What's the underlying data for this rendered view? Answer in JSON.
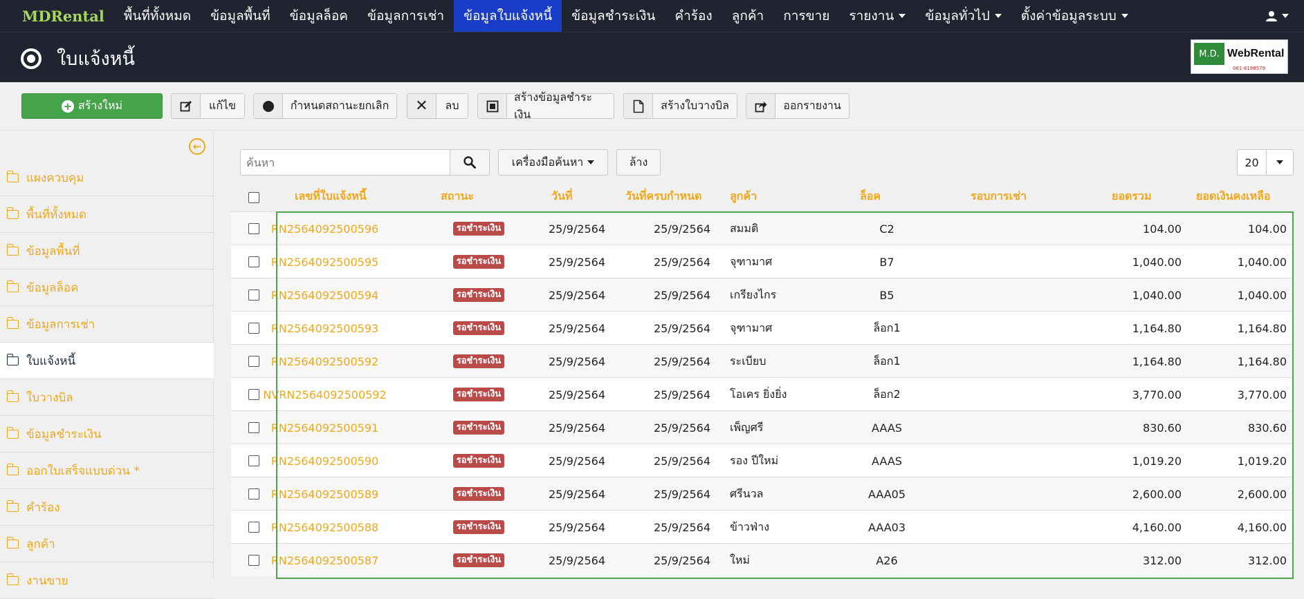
{
  "topnav": {
    "brand": "MDRental",
    "items": [
      {
        "label": "พื้นที่ทั้งหมด"
      },
      {
        "label": "ข้อมูลพื้นที่"
      },
      {
        "label": "ข้อมูลล็อค"
      },
      {
        "label": "ข้อมูลการเช่า"
      },
      {
        "label": "ข้อมูลใบแจ้งหนี้"
      },
      {
        "label": "ข้อมูลชำระเงิน"
      },
      {
        "label": "คำร้อง"
      },
      {
        "label": "ลูกค้า"
      },
      {
        "label": "การขาย"
      },
      {
        "label": "รายงาน"
      },
      {
        "label": "ข้อมูลทั่วไป"
      },
      {
        "label": "ตั้งค่าข้อมูลระบบ"
      }
    ],
    "active_index": 4,
    "user_icon": "user-icon"
  },
  "header": {
    "title": "ใบแจ้งหนี้",
    "icon": "target-icon",
    "logo": {
      "left": "M.D.",
      "right": "WebRental",
      "sub": "081-8198579"
    }
  },
  "toolbar": {
    "create_label": "สร้างใหม่",
    "edit_label": "แก้ไข",
    "cancel_status_label": "กำหนดสถานะยกเลิก",
    "delete_label": "ลบ",
    "create_payment_label": "สร้างข้อมูลชำระเงิน",
    "create_billing_label": "สร้างใบวางบิล",
    "export_label": "ออกรายงาน"
  },
  "sidebar": {
    "items": [
      {
        "label": "แผงควบคุม"
      },
      {
        "label": "พื้นที่ทั้งหมด"
      },
      {
        "label": "ข้อมูลพื้นที่"
      },
      {
        "label": "ข้อมูลล็อค"
      },
      {
        "label": "ข้อมูลการเช่า"
      },
      {
        "label": "ใบแจ้งหนี้"
      },
      {
        "label": "ใบวางบิล"
      },
      {
        "label": "ข้อมูลชำระเงิน"
      },
      {
        "label": "ออกใบเสร็จแบบด่วน *"
      },
      {
        "label": "คำร้อง"
      },
      {
        "label": "ลูกค้า"
      },
      {
        "label": "งานขาย"
      }
    ],
    "active_index": 5
  },
  "search": {
    "placeholder": "ค้นหา",
    "tools_label": "เครื่องมือค้นหา",
    "clear_label": "ล้าง",
    "page_size": "20"
  },
  "table": {
    "headers": [
      "เลขที่ใบแจ้งหนี้",
      "สถานะ",
      "วันที่",
      "วันที่ครบกำหนด",
      "ลูกค้า",
      "ล็อค",
      "รอบการเช่า",
      "ยอดรวม",
      "ยอดเงินคงเหลือ"
    ],
    "rows": [
      {
        "invoice_no": "RN2564092500596",
        "status": "รอชำระเงิน",
        "date": "25/9/2564",
        "due_date": "25/9/2564",
        "customer": "สมมติ",
        "lock": "C2",
        "period": "",
        "total": "104.00",
        "balance": "104.00"
      },
      {
        "invoice_no": "RN2564092500595",
        "status": "รอชำระเงิน",
        "date": "25/9/2564",
        "due_date": "25/9/2564",
        "customer": "จุฑามาศ",
        "lock": "B7",
        "period": "",
        "total": "1,040.00",
        "balance": "1,040.00"
      },
      {
        "invoice_no": "RN2564092500594",
        "status": "รอชำระเงิน",
        "date": "25/9/2564",
        "due_date": "25/9/2564",
        "customer": "เกรียงไกร",
        "lock": "B5",
        "period": "",
        "total": "1,040.00",
        "balance": "1,040.00"
      },
      {
        "invoice_no": "RN2564092500593",
        "status": "รอชำระเงิน",
        "date": "25/9/2564",
        "due_date": "25/9/2564",
        "customer": "จุฑามาศ",
        "lock": "ล็อก1",
        "period": "",
        "total": "1,164.80",
        "balance": "1,164.80"
      },
      {
        "invoice_no": "RN2564092500592",
        "status": "รอชำระเงิน",
        "date": "25/9/2564",
        "due_date": "25/9/2564",
        "customer": "ระเบียบ",
        "lock": "ล็อก1",
        "period": "",
        "total": "1,164.80",
        "balance": "1,164.80"
      },
      {
        "invoice_no": "NVRN2564092500592",
        "status": "รอชำระเงิน",
        "date": "25/9/2564",
        "due_date": "25/9/2564",
        "customer": "โอเคร ยิ่งยิ่ง",
        "lock": "ล็อก2",
        "period": "",
        "total": "3,770.00",
        "balance": "3,770.00"
      },
      {
        "invoice_no": "RN2564092500591",
        "status": "รอชำระเงิน",
        "date": "25/9/2564",
        "due_date": "25/9/2564",
        "customer": "เพ็ญศรี",
        "lock": "AAAS",
        "period": "",
        "total": "830.60",
        "balance": "830.60"
      },
      {
        "invoice_no": "RN2564092500590",
        "status": "รอชำระเงิน",
        "date": "25/9/2564",
        "due_date": "25/9/2564",
        "customer": "รอง ปีใหม่",
        "lock": "AAAS",
        "period": "",
        "total": "1,019.20",
        "balance": "1,019.20"
      },
      {
        "invoice_no": "RN2564092500589",
        "status": "รอชำระเงิน",
        "date": "25/9/2564",
        "due_date": "25/9/2564",
        "customer": "ศรีนวล",
        "lock": "AAA05",
        "period": "",
        "total": "2,600.00",
        "balance": "2,600.00"
      },
      {
        "invoice_no": "RN2564092500588",
        "status": "รอชำระเงิน",
        "date": "25/9/2564",
        "due_date": "25/9/2564",
        "customer": "ข้าวฟ่าง",
        "lock": "AAA03",
        "period": "",
        "total": "4,160.00",
        "balance": "4,160.00"
      },
      {
        "invoice_no": "RN2564092500587",
        "status": "รอชำระเงิน",
        "date": "25/9/2564",
        "due_date": "25/9/2564",
        "customer": "ใหม่",
        "lock": "A26",
        "period": "",
        "total": "312.00",
        "balance": "312.00"
      }
    ]
  },
  "colors": {
    "accent": "#f0a81a",
    "nav_bg": "#202330",
    "active_nav": "#1a3dc7",
    "create_green": "#45a44a",
    "status_red": "#b94a48",
    "selection_frame": "#4aa84a"
  }
}
